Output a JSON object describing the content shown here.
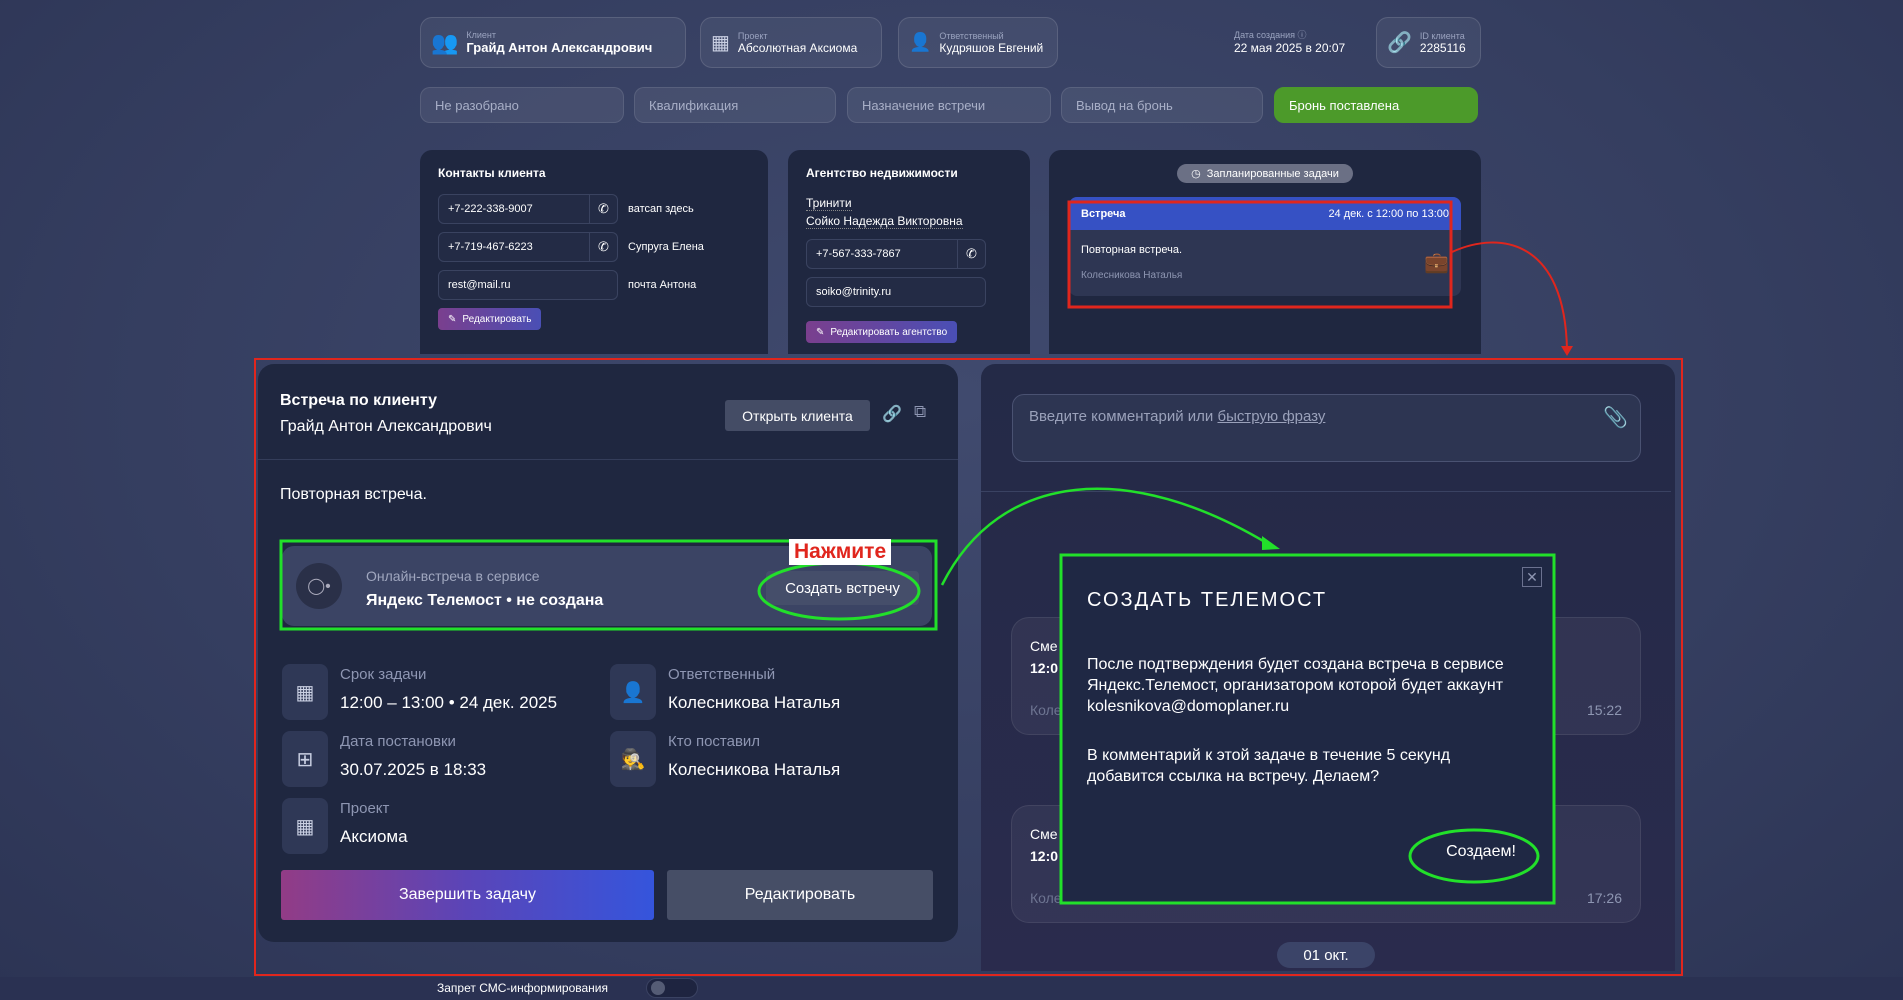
{
  "header": {
    "client": {
      "label": "Клиент",
      "value": "Грайд Антон Александрович"
    },
    "project": {
      "label": "Проект",
      "value": "Абсолютная Аксиома"
    },
    "responsible": {
      "label": "Ответственный",
      "value": "Кудряшов Евгений"
    },
    "created": {
      "label": "Дата создания",
      "value": "22 мая 2025 в 20:07"
    },
    "client_id": {
      "label": "ID клиента",
      "value": "2285116"
    }
  },
  "stages": [
    {
      "label": "Не разобрано"
    },
    {
      "label": "Квалификация"
    },
    {
      "label": "Назначение встречи"
    },
    {
      "label": "Вывод на бронь"
    },
    {
      "label": "Бронь поставлена",
      "active": true
    }
  ],
  "contacts": {
    "title": "Контакты клиента",
    "rows": [
      {
        "value": "+7-222-338-9007",
        "note": "ватсап здесь"
      },
      {
        "value": "+7-719-467-6223",
        "note": "Супруга Елена"
      },
      {
        "value": "rest@mail.ru",
        "note": "почта Антона"
      }
    ],
    "edit": "Редактировать"
  },
  "agency": {
    "title": "Агентство недвижимости",
    "name": "Тринити",
    "agent": "Сойко Надежда Викторовна",
    "phone": "+7-567-333-7867",
    "email": "soiko@trinity.ru",
    "edit": "Редактировать агентство"
  },
  "tasks": {
    "badge": "Запланированные задачи",
    "item": {
      "type": "Встреча",
      "when": "24 дек. с 12:00 по 13:00",
      "text": "Повторная встреча.",
      "author": "Колесникова Наталья"
    }
  },
  "task_card": {
    "title": "Встреча по клиенту",
    "client": "Грайд Антон Александрович",
    "open_client": "Открыть клиента",
    "description": "Повторная встреча.",
    "online": {
      "label": "Онлайн-встреча в сервисе",
      "status": "Яндекс Телемост • не создана",
      "button": "Создать встречу"
    },
    "fields": {
      "deadline": {
        "label": "Срок задачи",
        "value": "12:00 – 13:00 • 24 дек. 2025"
      },
      "responsible": {
        "label": "Ответственный",
        "value": "Колесникова Наталья"
      },
      "set_date": {
        "label": "Дата постановки",
        "value": "30.07.2025 в 18:33"
      },
      "set_by": {
        "label": "Кто поставил",
        "value": "Колесникова Наталья"
      },
      "project": {
        "label": "Проект",
        "value": "Аксиома"
      }
    },
    "complete": "Завершить задачу",
    "edit": "Редактировать"
  },
  "comments": {
    "placeholder": "Введите комментарий или ",
    "quick_phrase": "быструю фразу",
    "items": [
      {
        "line1": "Сме",
        "line2": "12:0",
        "author": "Коле",
        "time": "15:22"
      },
      {
        "line1": "Сме",
        "line2": "12:0",
        "author": "Коле",
        "time": "17:26"
      }
    ],
    "date_chip": "01 окт."
  },
  "modal": {
    "title": "СОЗДАТЬ ТЕЛЕМОСТ",
    "p1": "После подтверждения будет создана встреча в сервисе Яндекс.Телемост, организатором которой будет аккаунт kolesnikova@domoplaner.ru",
    "p2": "В комментарий к этой задаче в течение 5 секунд добавится ссылка на встречу. Делаем?",
    "confirm": "Создаем!"
  },
  "annotation": {
    "hint": "Нажмите"
  },
  "footer": {
    "sms_ban": "Запрет СМС-информирования"
  },
  "colors": {
    "accent_green": "#4c9a2a",
    "annotation_red": "#e0261d",
    "annotation_green": "#22e02a",
    "task_blue": "#3651c4"
  }
}
